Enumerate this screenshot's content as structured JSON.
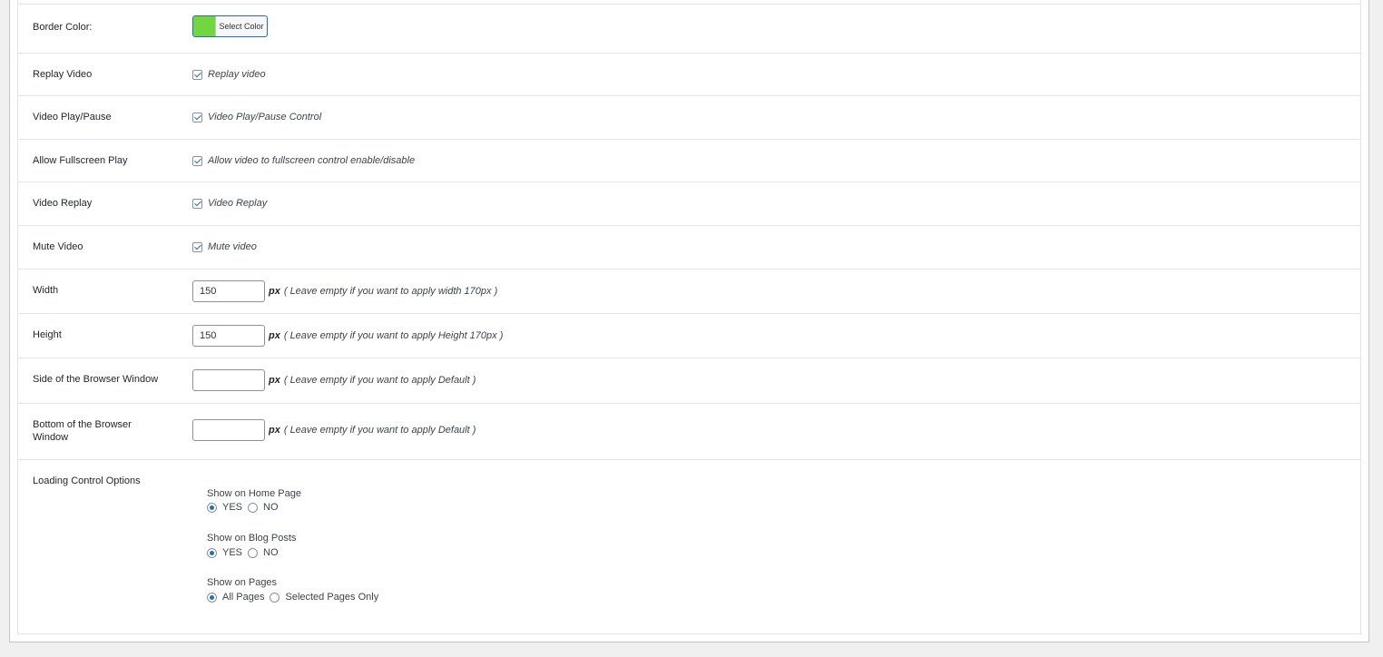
{
  "colors": {
    "border_color_swatch": "#71d63f",
    "accent": "#2271b1"
  },
  "border_color": {
    "label": "Border Color:",
    "button_label": "Select Color"
  },
  "checkbox_rows": [
    {
      "label": "Replay Video",
      "text": "Replay video",
      "checked": true
    },
    {
      "label": "Video Play/Pause",
      "text": "Video Play/Pause Control",
      "checked": true
    },
    {
      "label": "Allow Fullscreen Play",
      "text": "Allow video to fullscreen control enable/disable",
      "checked": true
    },
    {
      "label": "Video Replay",
      "text": "Video Replay",
      "checked": true
    },
    {
      "label": "Mute Video",
      "text": "Mute video",
      "checked": true
    }
  ],
  "input_rows": [
    {
      "label": "Width",
      "value": "150",
      "unit": "px",
      "hint": "( Leave empty if you want to apply width 170px )"
    },
    {
      "label": "Height",
      "value": "150",
      "unit": "px",
      "hint": "( Leave empty if you want to apply Height 170px )"
    },
    {
      "label": "Side of the Browser Window",
      "value": "",
      "unit": "px",
      "hint": "( Leave empty if you want to apply Default )"
    },
    {
      "label": "Bottom of the Browser Window",
      "value": "",
      "unit": "px",
      "hint": "( Leave empty if you want to apply Default )"
    }
  ],
  "loading": {
    "label": "Loading Control Options",
    "groups": [
      {
        "title": "Show on Home Page",
        "options": [
          {
            "label": "YES",
            "selected": true
          },
          {
            "label": "NO",
            "selected": false
          }
        ]
      },
      {
        "title": "Show on Blog Posts",
        "options": [
          {
            "label": "YES",
            "selected": true
          },
          {
            "label": "NO",
            "selected": false
          }
        ]
      },
      {
        "title": "Show on Pages",
        "options": [
          {
            "label": "All Pages",
            "selected": true
          },
          {
            "label": "Selected Pages Only",
            "selected": false
          }
        ]
      }
    ]
  }
}
